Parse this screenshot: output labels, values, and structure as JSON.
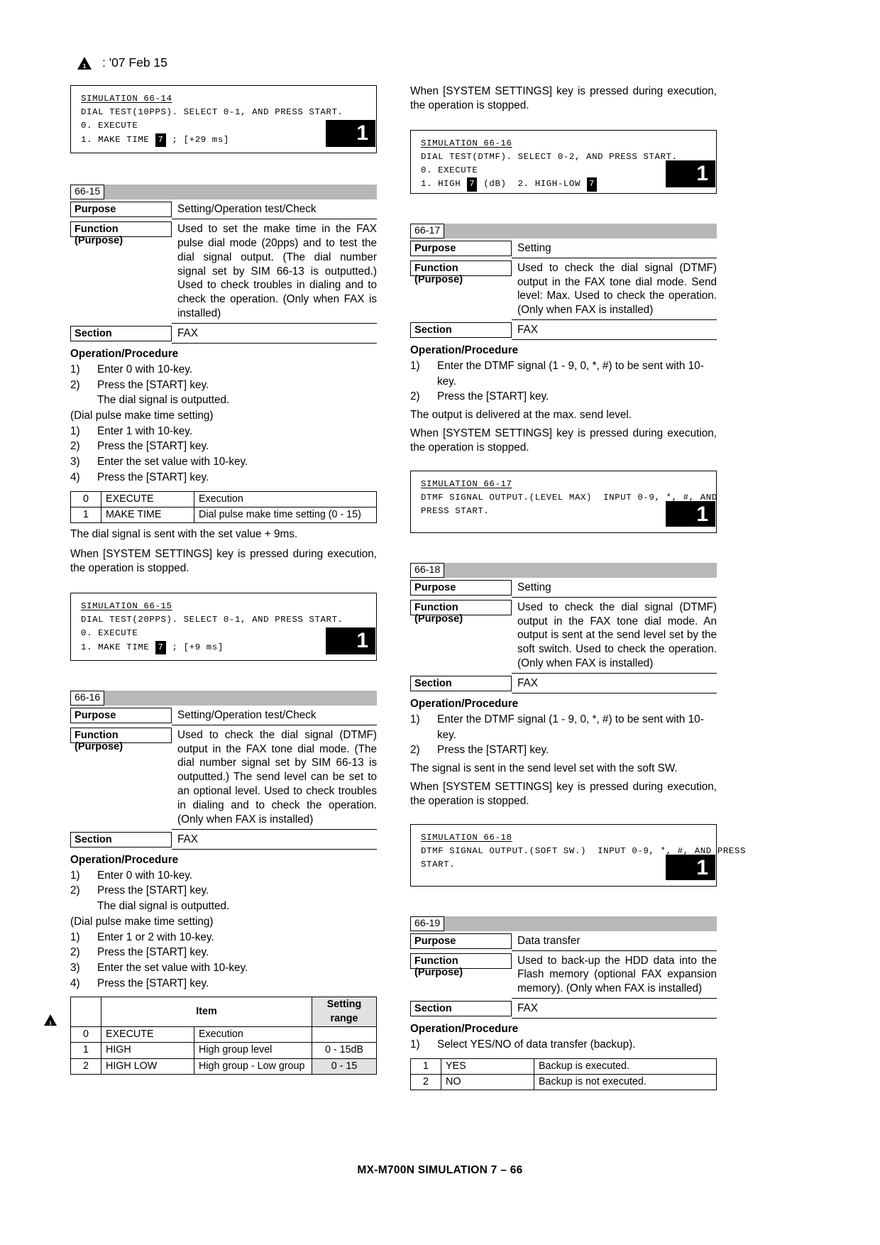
{
  "header": {
    "warning_icon": "warning-triangle-icon",
    "date_text": ": '07 Feb 15"
  },
  "footer": {
    "text": "MX-M700N  SIMULATION  7 – 66"
  },
  "sim_66_14_box": {
    "title": "SIMULATION 66-14",
    "line1": "DIAL TEST(10PPS). SELECT 0-1, AND PRESS START.",
    "line2": "0. EXECUTE",
    "line3_pre": "1. MAKE TIME ",
    "line3_val": "7",
    "line3_post": " ; [+29 ms]",
    "badge": "1"
  },
  "sim_66_15": {
    "id": "66-15",
    "purpose_label": "Purpose",
    "purpose_value": "Setting/Operation test/Check",
    "function_label": "Function (Purpose)",
    "function_value": "Used to set the make time in the FAX pulse dial mode (20pps) and to test the dial signal output. (The dial number signal set by SIM 66-13 is outputted.) Used to check troubles in dialing and to check the operation. (Only when FAX is installed)",
    "section_label": "Section",
    "section_value": "FAX",
    "op_title": "Operation/Procedure",
    "steps_a": [
      {
        "num": "1)",
        "text": "Enter 0 with 10-key."
      },
      {
        "num": "2)",
        "text": "Press the [START] key."
      }
    ],
    "sub_note": "The dial signal is outputted.",
    "group_note": "(Dial pulse make time setting)",
    "steps_b": [
      {
        "num": "1)",
        "text": "Enter 1 with 10-key."
      },
      {
        "num": "2)",
        "text": "Press the [START] key."
      },
      {
        "num": "3)",
        "text": "Enter the set value with 10-key."
      },
      {
        "num": "4)",
        "text": "Press the [START] key."
      }
    ],
    "table_rows": [
      {
        "idx": "0",
        "name": "EXECUTE",
        "desc": "Execution"
      },
      {
        "idx": "1",
        "name": "MAKE TIME",
        "desc": "Dial pulse make time setting (0 - 15)"
      }
    ],
    "after_table_1": "The dial signal is sent with the set value + 9ms.",
    "after_table_2": "When [SYSTEM SETTINGS] key is pressed during execution, the operation is stopped."
  },
  "sim_66_15_box": {
    "title": "SIMULATION 66-15",
    "line1": "DIAL TEST(20PPS). SELECT 0-1, AND PRESS START.",
    "line2": "0. EXECUTE",
    "line3_pre": "1. MAKE TIME ",
    "line3_val": "7",
    "line3_post": " ; [+9 ms]",
    "badge": "1"
  },
  "sim_66_16": {
    "id": "66-16",
    "purpose_label": "Purpose",
    "purpose_value": "Setting/Operation test/Check",
    "function_label": "Function (Purpose)",
    "function_value": "Used to check the dial signal (DTMF) output in the FAX tone dial mode. (The dial number signal set by SIM 66-13 is outputted.) The send level can be set to an optional level. Used to check troubles in dialing and to check the operation. (Only when FAX is installed)",
    "section_label": "Section",
    "section_value": "FAX",
    "op_title": "Operation/Procedure",
    "steps_a": [
      {
        "num": "1)",
        "text": "Enter 0 with 10-key."
      },
      {
        "num": "2)",
        "text": "Press the [START] key."
      }
    ],
    "sub_note": "The dial signal is outputted.",
    "group_note": "(Dial pulse make time setting)",
    "steps_b": [
      {
        "num": "1)",
        "text": "Enter 1 or 2 with 10-key."
      },
      {
        "num": "2)",
        "text": "Press the [START] key."
      },
      {
        "num": "3)",
        "text": "Enter the set value with 10-key."
      },
      {
        "num": "4)",
        "text": "Press the [START] key."
      }
    ],
    "table_header": {
      "item": "Item",
      "setting_range_l1": "Setting",
      "setting_range_l2": "range"
    },
    "table_rows": [
      {
        "idx": "0",
        "name": "EXECUTE",
        "desc": "Execution",
        "range": ""
      },
      {
        "idx": "1",
        "name": "HIGH",
        "desc": "High group level",
        "range": "0 - 15dB"
      },
      {
        "idx": "2",
        "name": "HIGH LOW",
        "desc": "High group - Low group",
        "range": "0 - 15"
      }
    ]
  },
  "right_top_note": "When [SYSTEM SETTINGS] key is pressed during execution, the operation is stopped.",
  "sim_66_16_box": {
    "title": "SIMULATION 66-16",
    "line1": "DIAL TEST(DTMF). SELECT 0-2, AND PRESS START.",
    "line2": "0. EXECUTE",
    "line3_a": "1. HIGH ",
    "line3_val_a": "7",
    "line3_b": " (dB)  2. HIGH-LOW ",
    "line3_val_b": "7",
    "badge": "1"
  },
  "sim_66_17": {
    "id": "66-17",
    "purpose_label": "Purpose",
    "purpose_value": "Setting",
    "function_label": "Function (Purpose)",
    "function_value": "Used to check the dial signal (DTMF) output in the FAX tone dial mode.  Send level: Max. Used to check the operation. (Only when FAX is installed)",
    "section_label": "Section",
    "section_value": "FAX",
    "op_title": "Operation/Procedure",
    "steps": [
      {
        "num": "1)",
        "text": "Enter the DTMF signal (1 - 9, 0, *, #) to be sent with 10-key."
      },
      {
        "num": "2)",
        "text": "Press the [START] key."
      }
    ],
    "note1": "The output is delivered at the max. send level.",
    "note2": "When [SYSTEM SETTINGS] key is pressed during execution, the operation is stopped."
  },
  "sim_66_17_box": {
    "title": "SIMULATION 66-17",
    "line1": "DTMF SIGNAL OUTPUT.(LEVEL MAX)  INPUT 0-9, *, #, AND",
    "line2": "PRESS START.",
    "badge": "1"
  },
  "sim_66_18": {
    "id": "66-18",
    "purpose_label": "Purpose",
    "purpose_value": "Setting",
    "function_label": "Function (Purpose)",
    "function_value": "Used to check the dial signal (DTMF) output in the FAX tone dial mode.  An output is sent at the send level set by the soft switch. Used to check the operation. (Only when FAX is installed)",
    "section_label": "Section",
    "section_value": "FAX",
    "op_title": "Operation/Procedure",
    "steps": [
      {
        "num": "1)",
        "text": "Enter the DTMF signal (1 - 9, 0, *, #) to be sent with 10-key."
      },
      {
        "num": "2)",
        "text": "Press the [START] key."
      }
    ],
    "note1": "The signal is sent in the send level set with the soft SW.",
    "note2": "When [SYSTEM SETTINGS] key is pressed during execution, the operation is stopped."
  },
  "sim_66_18_box": {
    "title": "SIMULATION 66-18",
    "line1": "DTMF SIGNAL OUTPUT.(SOFT SW.)  INPUT 0-9, *, #, AND PRESS",
    "line2": "START.",
    "badge": "1"
  },
  "sim_66_19": {
    "id": "66-19",
    "purpose_label": "Purpose",
    "purpose_value": "Data transfer",
    "function_label": "Function (Purpose)",
    "function_value": "Used to back-up the HDD data into the Flash memory (optional FAX expansion memory). (Only when FAX is installed)",
    "section_label": "Section",
    "section_value": "FAX",
    "op_title": "Operation/Procedure",
    "steps": [
      {
        "num": "1)",
        "text": "Select YES/NO of data transfer (backup)."
      }
    ],
    "table_rows": [
      {
        "idx": "1",
        "name": "YES",
        "desc": "Backup is executed."
      },
      {
        "idx": "2",
        "name": "NO",
        "desc": "Backup is not executed."
      }
    ]
  }
}
